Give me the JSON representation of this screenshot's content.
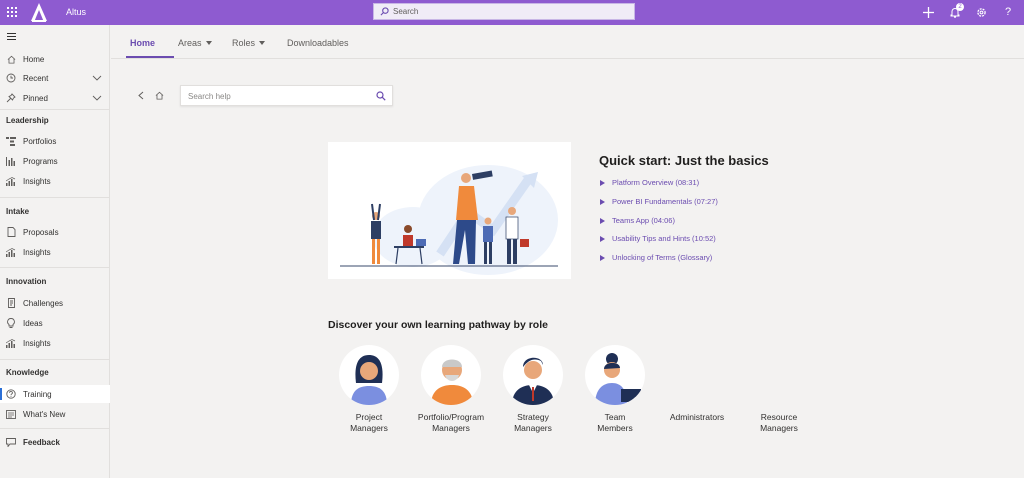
{
  "topbar": {
    "app_name": "Altus",
    "search_placeholder": "Search",
    "notification_count": "2",
    "help_label": "?"
  },
  "sidebar": {
    "items": [
      {
        "label": "Home"
      },
      {
        "label": "Recent"
      },
      {
        "label": "Pinned"
      }
    ],
    "sections": [
      {
        "title": "Leadership",
        "items": [
          {
            "label": "Portfolios"
          },
          {
            "label": "Programs"
          },
          {
            "label": "Insights"
          }
        ]
      },
      {
        "title": "Intake",
        "items": [
          {
            "label": "Proposals"
          },
          {
            "label": "Insights"
          }
        ]
      },
      {
        "title": "Innovation",
        "items": [
          {
            "label": "Challenges"
          },
          {
            "label": "Ideas"
          },
          {
            "label": "Insights"
          }
        ]
      },
      {
        "title": "Knowledge",
        "items": [
          {
            "label": "Training"
          },
          {
            "label": "What's New"
          }
        ]
      }
    ],
    "feedback_label": "Feedback",
    "active_item": "Training"
  },
  "tabs": [
    {
      "label": "Home"
    },
    {
      "label": "Areas"
    },
    {
      "label": "Roles"
    },
    {
      "label": "Downloadables"
    }
  ],
  "help": {
    "search_placeholder": "Search help"
  },
  "quickstart": {
    "title": "Quick start: Just the basics",
    "items": [
      {
        "label": "Platform Overview (08:31)"
      },
      {
        "label": "Power BI Fundamentals (07:27)"
      },
      {
        "label": "Teams App (04:06)"
      },
      {
        "label": "Usability Tips and Hints (10:52)"
      },
      {
        "label": "Unlocking of Terms (Glossary)"
      }
    ]
  },
  "discover": {
    "title": "Discover your own learning pathway by role",
    "roles": [
      {
        "line1": "Project",
        "line2": "Managers"
      },
      {
        "line1": "Portfolio/Program",
        "line2": "Managers"
      },
      {
        "line1": "Strategy",
        "line2": "Managers"
      },
      {
        "line1": "Team",
        "line2": "Members"
      },
      {
        "line1": "Administrators",
        "line2": ""
      },
      {
        "line1": "Resource",
        "line2": "Managers"
      }
    ]
  },
  "colors": {
    "brand": "#8e5bd0",
    "accent": "#6b4cb0",
    "active_indicator": "#2b6fd6"
  }
}
